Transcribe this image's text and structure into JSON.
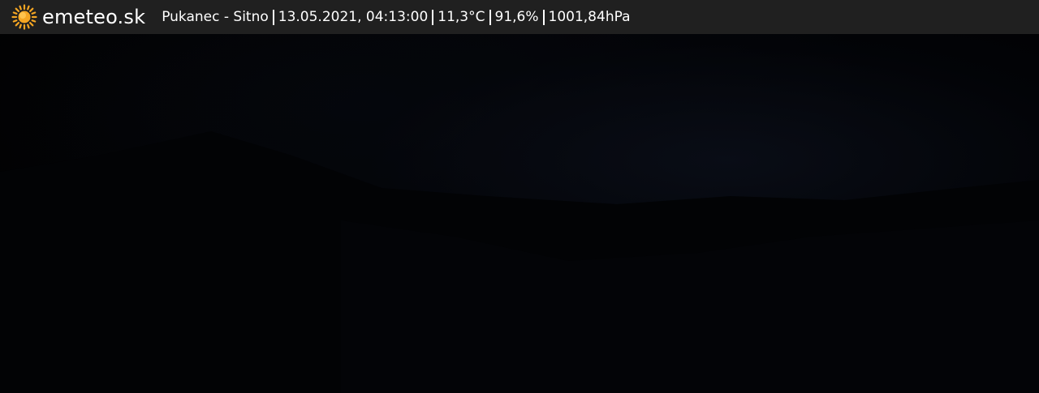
{
  "header": {
    "brand": "emeteo.sk",
    "logo_icon": "sun-icon",
    "station": "Pukanec - Sitno",
    "datetime": "13.05.2021, 04:13:00",
    "temperature": "11,3°C",
    "humidity": "91,6%",
    "pressure": "1001,84hPa"
  },
  "colors": {
    "bar_background": "#202020",
    "text": "#ffffff",
    "sun": "#f5a623",
    "image_background": "#000000"
  }
}
